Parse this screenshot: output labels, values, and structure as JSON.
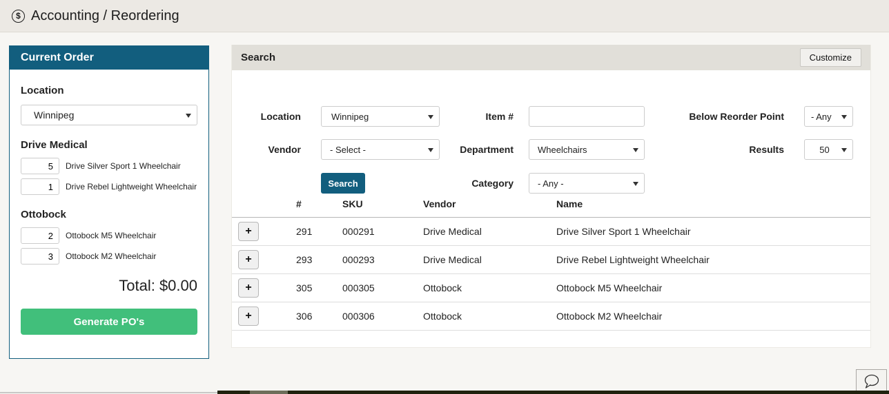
{
  "header": {
    "icon": "$",
    "title": "Accounting / Reordering"
  },
  "colors": {
    "teal": "#125e7e",
    "green": "#41bf7b",
    "topbar_bg": "#ece9e4",
    "page_bg": "#f7f6f3",
    "panel_header_bg": "#e1dfd9"
  },
  "current_order": {
    "title": "Current Order",
    "location_label": "Location",
    "location_value": "Winnipeg",
    "groups": [
      {
        "vendor": "Drive Medical",
        "items": [
          {
            "qty": "5",
            "name": "Drive Silver Sport 1 Wheelchair"
          },
          {
            "qty": "1",
            "name": "Drive Rebel Lightweight Wheelchair"
          }
        ]
      },
      {
        "vendor": "Ottobock",
        "items": [
          {
            "qty": "2",
            "name": "Ottobock M5 Wheelchair"
          },
          {
            "qty": "3",
            "name": "Ottobock M2 Wheelchair"
          }
        ]
      }
    ],
    "total_label": "Total: $0.00",
    "generate_button": "Generate PO's"
  },
  "search_panel": {
    "title": "Search",
    "customize_button": "Customize",
    "search_button": "Search",
    "fields": {
      "location": {
        "label": "Location",
        "value": "Winnipeg"
      },
      "item_number": {
        "label": "Item #",
        "value": ""
      },
      "below_reorder_point": {
        "label": "Below Reorder Point",
        "value": "- Any"
      },
      "vendor": {
        "label": "Vendor",
        "value": "- Select -"
      },
      "department": {
        "label": "Department",
        "value": "Wheelchairs"
      },
      "results": {
        "label": "Results",
        "value": "50"
      },
      "category": {
        "label": "Category",
        "value": "- Any -"
      }
    },
    "table": {
      "columns": [
        "#",
        "SKU",
        "Vendor",
        "Name"
      ],
      "add_button": "+",
      "rows": [
        {
          "num": "291",
          "sku": "000291",
          "vendor": "Drive Medical",
          "name": "Drive Silver Sport 1 Wheelchair"
        },
        {
          "num": "293",
          "sku": "000293",
          "vendor": "Drive Medical",
          "name": "Drive Rebel Lightweight Wheelchair"
        },
        {
          "num": "305",
          "sku": "000305",
          "vendor": "Ottobock",
          "name": "Ottobock M5 Wheelchair"
        },
        {
          "num": "306",
          "sku": "000306",
          "vendor": "Ottobock",
          "name": "Ottobock M2 Wheelchair"
        }
      ]
    }
  }
}
